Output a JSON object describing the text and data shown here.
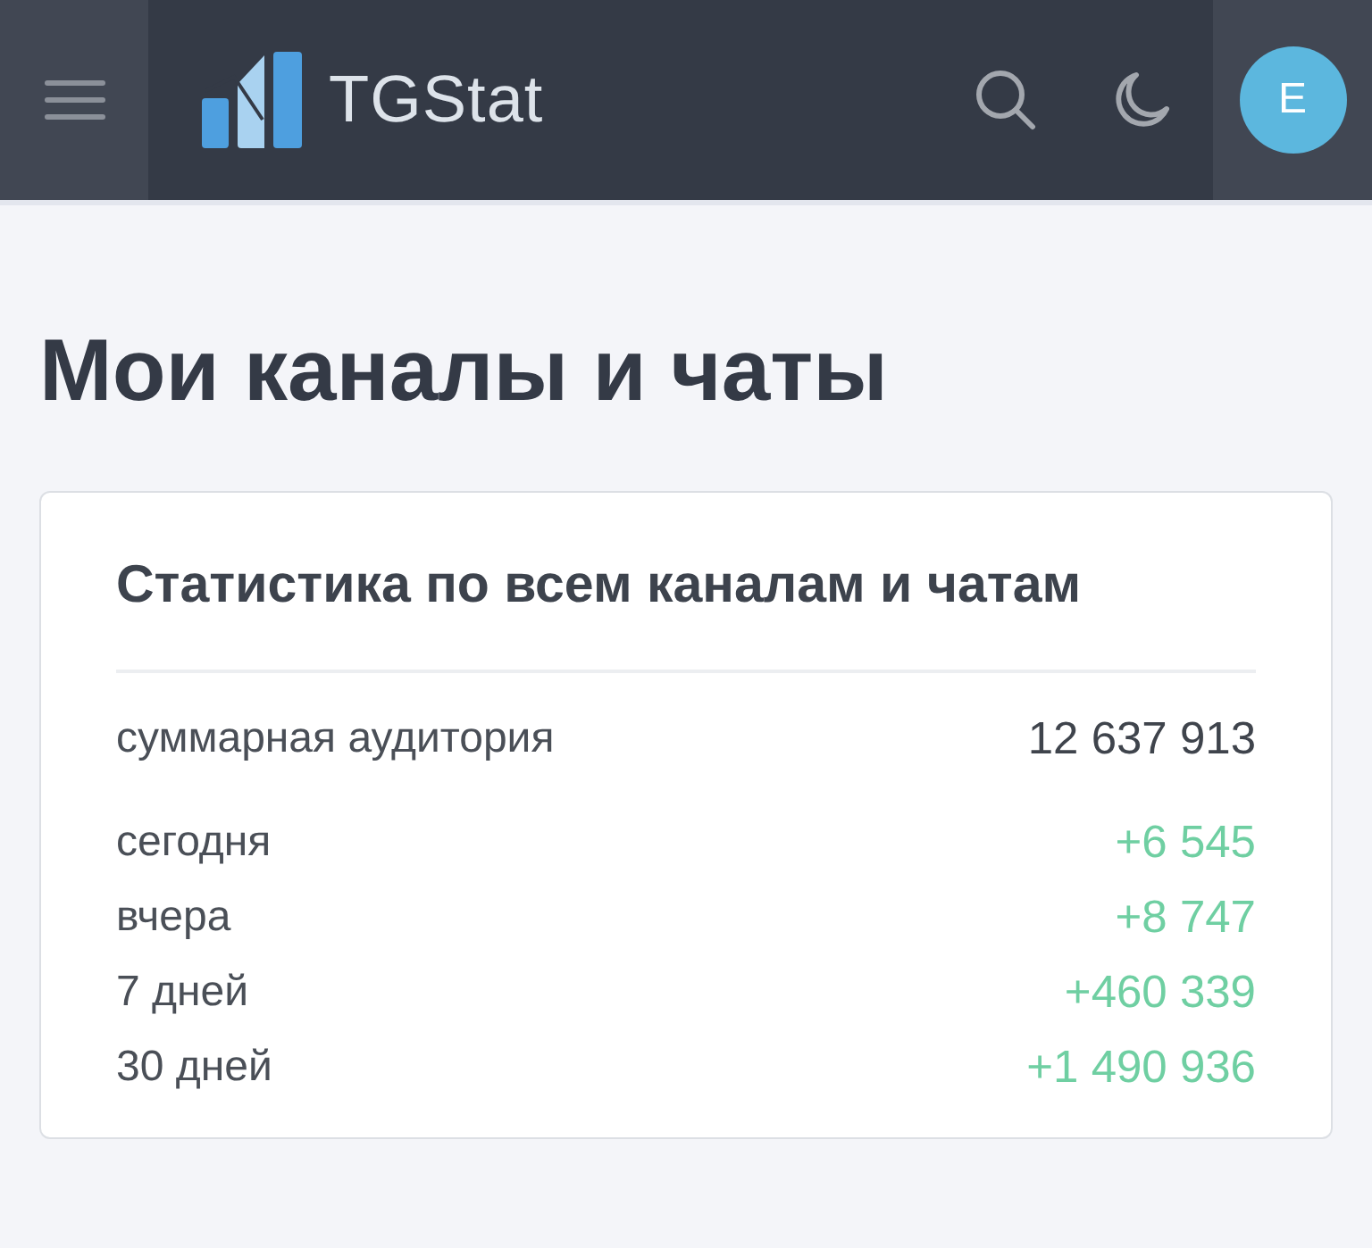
{
  "header": {
    "logo_text": "TGStat",
    "avatar_letter": "E"
  },
  "page_title": "Мои каналы и чаты",
  "stats_card": {
    "title": "Статистика по всем каналам и чатам",
    "total": {
      "label": "суммарная аудитория",
      "value": "12 637 913"
    },
    "changes": [
      {
        "label": "сегодня",
        "value": "+6 545"
      },
      {
        "label": "вчера",
        "value": "+8 747"
      },
      {
        "label": "7 дней",
        "value": "+460 339"
      },
      {
        "label": "30 дней",
        "value": "+1 490 936"
      }
    ]
  }
}
